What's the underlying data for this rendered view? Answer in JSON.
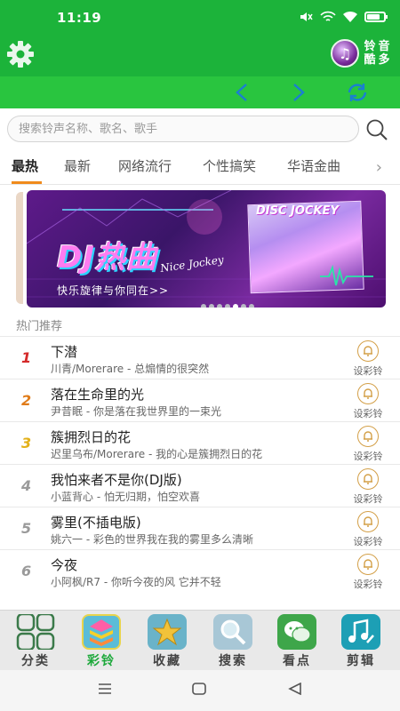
{
  "status_bar": {
    "time": "11:19",
    "battery_level": 0.8
  },
  "app_bar": {
    "brand_chars": [
      "铃",
      "音",
      "酷",
      "多"
    ],
    "logo_icon": "music-note-icon"
  },
  "nav_bar": {
    "prev_icon": "chevron-left-icon",
    "next_icon": "chevron-right-icon",
    "refresh_icon": "refresh-icon"
  },
  "search": {
    "placeholder": "搜索铃声名称、歌名、歌手",
    "value": ""
  },
  "tabs": [
    {
      "label": "最热",
      "active": true
    },
    {
      "label": "最新",
      "active": false
    },
    {
      "label": "网络流行",
      "active": false
    },
    {
      "label": "个性搞笑",
      "active": false
    },
    {
      "label": "华语金曲",
      "active": false
    }
  ],
  "banner": {
    "headline": "DJ热曲",
    "script": "Nice Jockey",
    "subtitle": "快乐旋律与你同在>>",
    "album_text": "DISC JOCKEY",
    "dots": 7,
    "active_dot": 4
  },
  "section_title": "热门推荐",
  "ring_label": "设彩铃",
  "songs": [
    {
      "rank": "1",
      "title": "下潜",
      "meta": "川青/Morerare - 总煽情的很突然",
      "rank_color": "#d42a2a"
    },
    {
      "rank": "2",
      "title": "落在生命里的光",
      "meta": "尹昔眠 - 你是落在我世界里的一束光",
      "rank_color": "#e07c1a"
    },
    {
      "rank": "3",
      "title": "簇拥烈日的花",
      "meta": "迟里乌布/Morerare - 我的心是簇拥烈日的花",
      "rank_color": "#e3b11a"
    },
    {
      "rank": "4",
      "title": "我怕来者不是你(DJ版)",
      "meta": "小蓝背心 - 怕无归期，怕空欢喜",
      "rank_color": "#9a9a9a"
    },
    {
      "rank": "5",
      "title": "雾里(不插电版)",
      "meta": "姚六一 - 彩色的世界我在我的雾里多么清晰",
      "rank_color": "#9a9a9a"
    },
    {
      "rank": "6",
      "title": "今夜",
      "meta": "小阿枫/R7 - 你听今夜的风 它并不轻",
      "rank_color": "#9a9a9a"
    }
  ],
  "bottom_nav": [
    {
      "label": "分类",
      "icon": "grid-icon",
      "active": false
    },
    {
      "label": "彩铃",
      "icon": "colorful-stack-icon",
      "active": true
    },
    {
      "label": "收藏",
      "icon": "star-icon",
      "active": false
    },
    {
      "label": "搜索",
      "icon": "magnifier-icon",
      "active": false
    },
    {
      "label": "看点",
      "icon": "chat-bubbles-icon",
      "active": false
    },
    {
      "label": "剪辑",
      "icon": "music-edit-icon",
      "active": false
    }
  ],
  "colors": {
    "primary_green": "#1cb33a",
    "accent_orange": "#f08b1c",
    "bell_gold": "#d39f47"
  }
}
